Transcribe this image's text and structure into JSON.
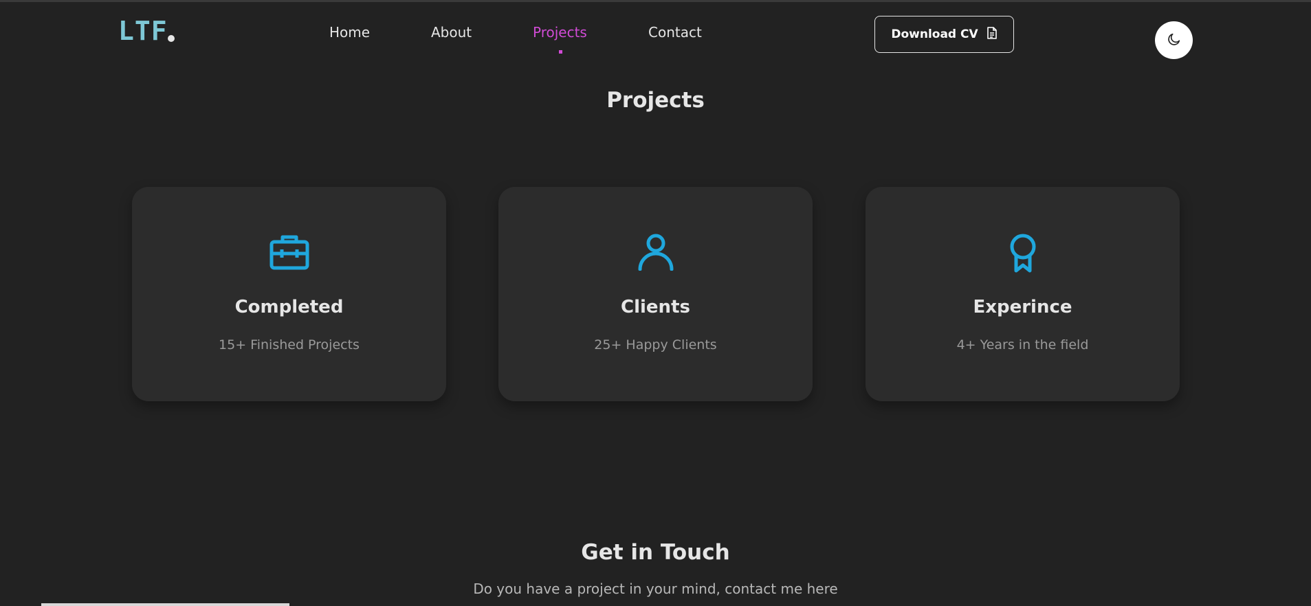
{
  "brand": {
    "logo_text": "LTF"
  },
  "nav": {
    "items": [
      {
        "label": "Home"
      },
      {
        "label": "About"
      },
      {
        "label": "Projects"
      },
      {
        "label": "Contact"
      }
    ],
    "active_label": "Projects"
  },
  "header": {
    "cv_button_label": "Download CV",
    "cv_icon": "document-icon",
    "theme_icon": "moon-icon"
  },
  "projects": {
    "title": "Projects",
    "cards": [
      {
        "icon": "briefcase-icon",
        "title": "Completed",
        "subtitle": "15+ Finished Projects"
      },
      {
        "icon": "user-icon",
        "title": "Clients",
        "subtitle": "25+ Happy Clients"
      },
      {
        "icon": "award-icon",
        "title": "Experince",
        "subtitle": "4+ Years in the field"
      }
    ]
  },
  "contact": {
    "title": "Get in Touch",
    "subtitle": "Do you have a project in your mind, contact me here"
  },
  "colors": {
    "background": "#222222",
    "card": "#2c2c2c",
    "accent_icon": "#1fa7dd",
    "active_nav": "#d14bd6",
    "logo": "#7ec8d6"
  }
}
